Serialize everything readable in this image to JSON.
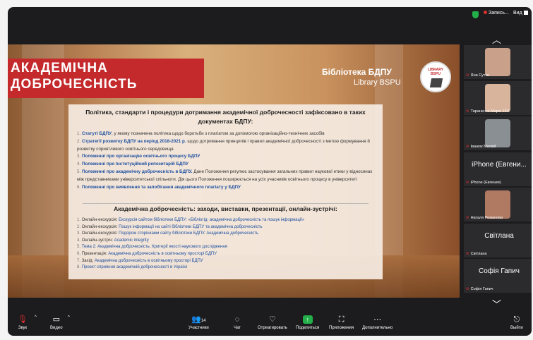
{
  "topbar": {
    "recording": "Запись...",
    "view": "Вид"
  },
  "slide": {
    "title_line1": "АКАДЕМІЧНА",
    "title_line2": "ДОБРОЧЕСНІСТЬ",
    "library_ua": "Бібліотека БДПУ",
    "library_en": "Library BSPU",
    "logo_text": "LIBRARY BSPU",
    "heading": "Політика, стандарти і процедури дотримання академічної доброчесності зафіксовано в таких документах БДПУ:",
    "items": [
      {
        "n": "1.",
        "strong": "Статуті БДПУ",
        "text": ", у якому позначена політика щодо боротьби з плагіатом за допомогою організаційно-технічних засобів"
      },
      {
        "n": "2.",
        "strong": "Стратегії розвитку БДПУ на період 2018-2021 р.",
        "text": " щодо дотримання принципів і правил академічної доброчесності з метою формування й розвитку сприятливого освітнього середовища"
      },
      {
        "n": "3.",
        "strong": "Положенні про організацію освітнього процесу БДПУ",
        "text": ""
      },
      {
        "n": "4.",
        "strong": "Положенні про Інституційний репозитарій БДПУ",
        "text": ""
      },
      {
        "n": "5.",
        "strong": "Положенні про академічну доброчесність в БДПУ.",
        "text": " Дане Положення регулює застосування загальних правил наукової етики у відносинах між представниками університетської спільноти. Дія цього Положення поширюється на усіх учасників освітнього процесу в університеті"
      },
      {
        "n": "6.",
        "strong": "Положенні про виявлення та запобігання академічного плагіату у БДПУ",
        "text": ""
      }
    ],
    "subheading": "Академічна доброчесність: заходи, виставки, презентації, онлайн-зустрічі:",
    "events": [
      {
        "n": "1.",
        "label": "Онлайн-екскурсія: ",
        "text": "Екскурсія сайтом бібліотеки БДПУ: «Бібліогід: академічна доброчесність та пошук інформації»"
      },
      {
        "n": "2.",
        "label": "Онлайн-екскурсія: ",
        "text": "Пошук інформації на сайті бібліотеки БДПУ та академічна доброчесність"
      },
      {
        "n": "3.",
        "label": "Онлайн-екскурсія: ",
        "text": "Подорож сторінками сайту бібліотеки БДПУ. Академічна доброчесність"
      },
      {
        "n": "4.",
        "label": "Онлайн-зустріч: ",
        "text": "Academic integrity"
      },
      {
        "n": "5.",
        "label": "",
        "text": "Тема 2: Академічна доброчесність. Критерії якості наукового дослідження"
      },
      {
        "n": "6.",
        "label": "Презентація: ",
        "text": "Академічна доброчесність в освітньому просторі БДПУ"
      },
      {
        "n": "7.",
        "label": "Захід: ",
        "text": "Академічна доброчесність в освітньому просторі БДПУ"
      },
      {
        "n": "8.",
        "label": "",
        "text": "Проект сприяння академічній доброчесності в Україні"
      }
    ]
  },
  "participants": [
    {
      "name": "Яна Сутко",
      "big": ""
    },
    {
      "name": "Тараненко Марія 15Х",
      "big": ""
    },
    {
      "name": "Іванюк Матвій",
      "big": ""
    },
    {
      "name": "iPhone (Евгения)",
      "big": "iPhone (Евгени..."
    },
    {
      "name": "Наталя Романова",
      "big": ""
    },
    {
      "name": "Світлана",
      "big": "Світлана"
    },
    {
      "name": "Софія Гапич",
      "big": "Софія Гапич"
    }
  ],
  "toolbar": {
    "audio": "Звук",
    "video": "Видео",
    "participants": "Участники",
    "participants_count": "14",
    "chat": "Чат",
    "react": "Отреагировать",
    "share": "Поделиться",
    "apps": "Приложения",
    "more": "Дополнительно",
    "leave": "Выйти"
  }
}
